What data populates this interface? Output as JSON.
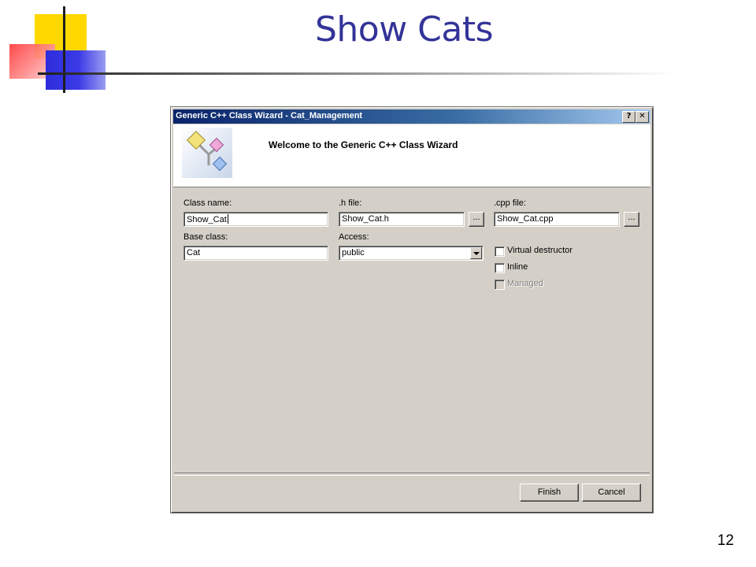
{
  "slide": {
    "title": "Show Cats",
    "page_number": "12"
  },
  "dialog": {
    "title": "Generic C++ Class Wizard - Cat_Management",
    "help_glyph": "?",
    "close_glyph": "✕",
    "banner_title": "Welcome to the Generic C++ Class Wizard",
    "class_name": {
      "label": "Class name:",
      "value": "Show_Cat"
    },
    "h_file": {
      "label": ".h file:",
      "value": "Show_Cat.h",
      "browse": "..."
    },
    "cpp_file": {
      "label": ".cpp file:",
      "value": "Show_Cat.cpp",
      "browse": "..."
    },
    "base_class": {
      "label": "Base class:",
      "value": "Cat"
    },
    "access": {
      "label": "Access:",
      "value": "public"
    },
    "options": [
      {
        "label": "Virtual destructor",
        "checked": false,
        "enabled": true
      },
      {
        "label": "Inline",
        "checked": false,
        "enabled": true
      },
      {
        "label": "Managed",
        "checked": false,
        "enabled": false
      }
    ],
    "finish_label": "Finish",
    "cancel_label": "Cancel"
  },
  "colors": {
    "slide_title": "#333399",
    "dialog_face": "#d4d0c8",
    "titlebar_start": "#0a246a",
    "titlebar_end": "#a6caf0"
  }
}
